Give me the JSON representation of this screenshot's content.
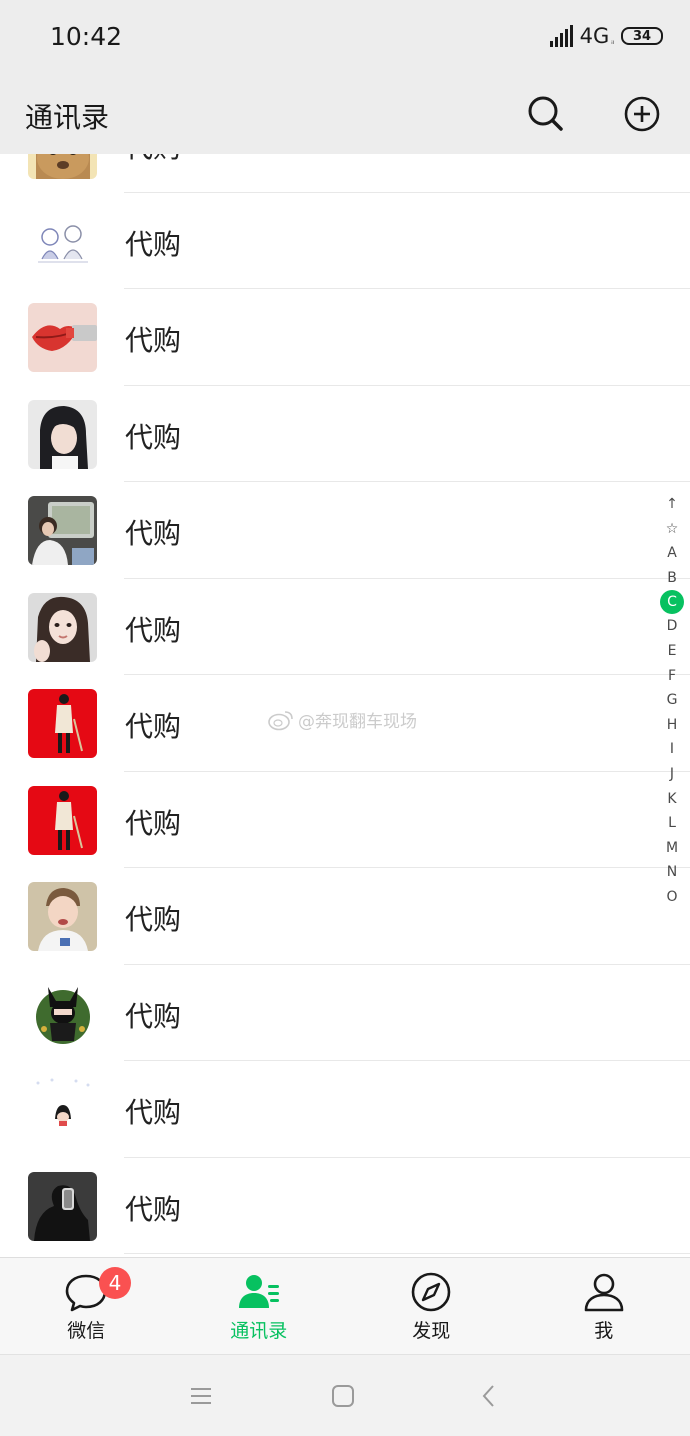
{
  "status_bar": {
    "time": "10:42",
    "network": "4G",
    "network_small": "ᵢₗ",
    "battery": "34"
  },
  "header": {
    "title": "通讯录",
    "search_icon": "search-icon",
    "add_icon": "add-circle-icon"
  },
  "contacts": [
    {
      "name": "代购",
      "avatar": "cat-avatar"
    },
    {
      "name": "代购",
      "avatar": "sketch-avatar"
    },
    {
      "name": "代购",
      "avatar": "lips-avatar"
    },
    {
      "name": "代购",
      "avatar": "girl-avatar"
    },
    {
      "name": "代购",
      "avatar": "car-avatar"
    },
    {
      "name": "代购",
      "avatar": "selfie-avatar"
    },
    {
      "name": "代购",
      "avatar": "red-figure-avatar"
    },
    {
      "name": "代购",
      "avatar": "red-figure-avatar"
    },
    {
      "name": "代购",
      "avatar": "boy-avatar"
    },
    {
      "name": "代购",
      "avatar": "cat-mask-avatar"
    },
    {
      "name": "代购",
      "avatar": "maruko-avatar"
    },
    {
      "name": "代购",
      "avatar": "dark-avatar"
    }
  ],
  "alphabet_index": [
    "↑",
    "☆",
    "A",
    "B",
    "C",
    "D",
    "E",
    "F",
    "G",
    "H",
    "I",
    "J",
    "K",
    "L",
    "M",
    "N",
    "O"
  ],
  "alphabet_active": "C",
  "watermark": "@奔现翻车现场",
  "tabs": [
    {
      "label": "微信",
      "icon": "chat-bubble-icon",
      "badge": "4"
    },
    {
      "label": "通讯录",
      "icon": "contacts-icon"
    },
    {
      "label": "发现",
      "icon": "compass-icon"
    },
    {
      "label": "我",
      "icon": "person-icon"
    }
  ],
  "colors": {
    "accent": "#07c160",
    "badge": "#fa5151",
    "bar_bg": "#ededed"
  },
  "system_nav": {
    "menu_icon": "menu-icon",
    "home_icon": "home-square-icon",
    "back_icon": "back-chevron-icon"
  }
}
